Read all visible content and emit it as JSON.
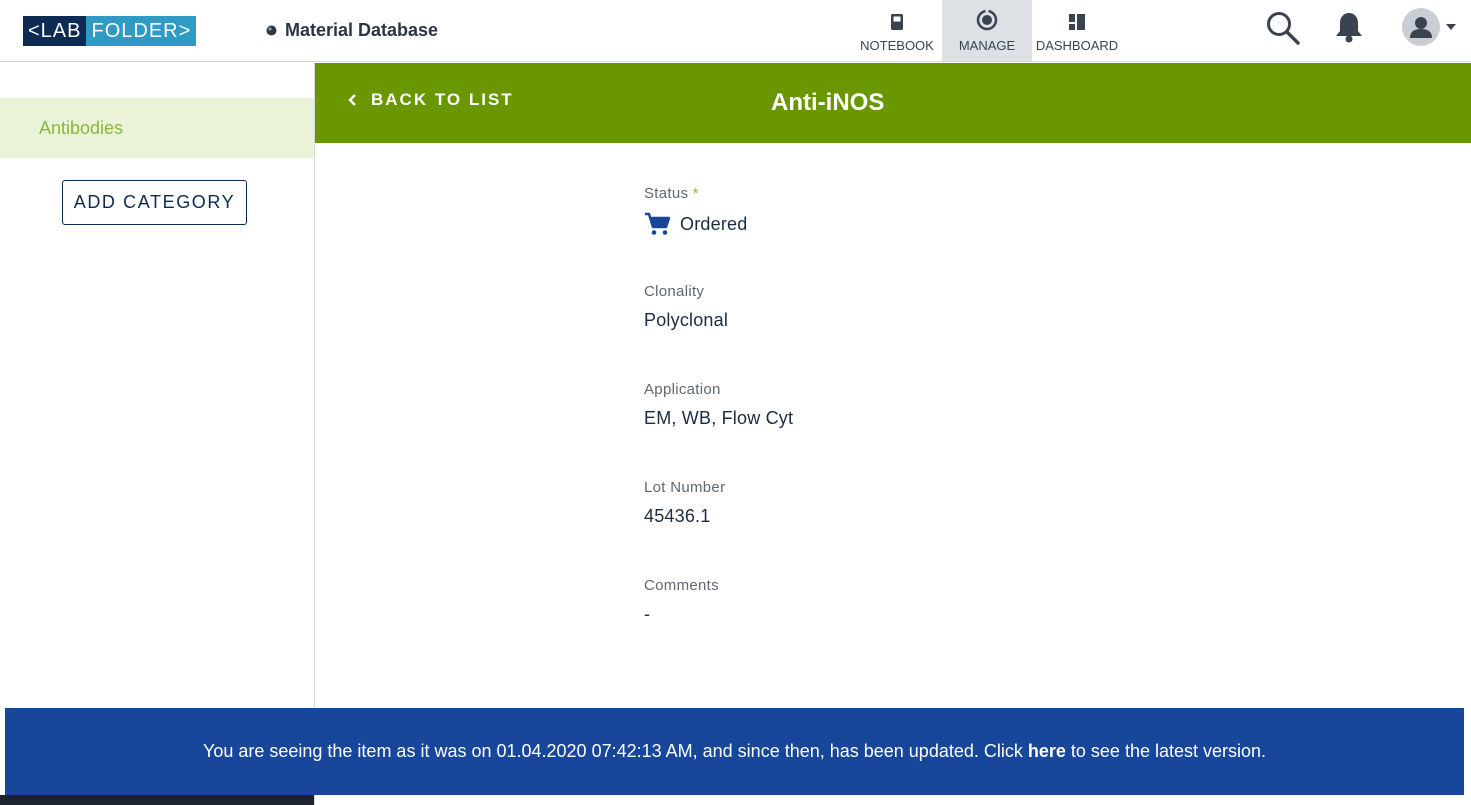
{
  "brand": {
    "logo_left": "<LAB",
    "logo_right": "FOLDER>"
  },
  "breadcrumb": {
    "title": "Material Database"
  },
  "nav": {
    "tabs": [
      {
        "label": "NOTEBOOK",
        "icon": "notebook-icon"
      },
      {
        "label": "MANAGE",
        "icon": "manage-icon",
        "active": true
      },
      {
        "label": "DASHBOARD",
        "icon": "dashboard-icon"
      }
    ]
  },
  "sidebar": {
    "categories": [
      {
        "label": "Antibodies",
        "selected": true
      }
    ],
    "add_category_label": "ADD CATEGORY"
  },
  "header": {
    "back_label": "BACK TO LIST",
    "item_title": "Anti-iNOS"
  },
  "fields": [
    {
      "label": "Status",
      "required_mark": "*",
      "value": "Ordered",
      "icon": "cart-icon"
    },
    {
      "label": "Clonality",
      "value": "Polyclonal"
    },
    {
      "label": "Application",
      "value": "EM, WB, Flow Cyt"
    },
    {
      "label": "Lot Number",
      "value": "45436.1"
    },
    {
      "label": "Comments",
      "value": "-"
    }
  ],
  "notice": {
    "text_before": "You are seeing the item as it was on 01.04.2020 07:42:13 AM, and since then, has been updated. Click",
    "link_label": "here",
    "text_after": "to see the latest version."
  },
  "colors": {
    "accent_green": "#6a9700",
    "selected_bg": "#eaf3d7",
    "selected_text": "#8cb63c",
    "brand_navy": "#0d2b52",
    "brand_teal": "#2f9bc4",
    "notice_blue": "#17469b",
    "status_icon": "#17469b"
  }
}
